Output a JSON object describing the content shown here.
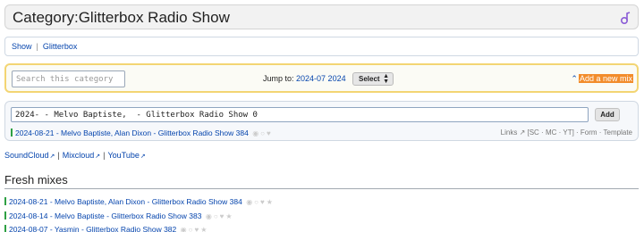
{
  "header": {
    "title": "Category:Glitterbox Radio Show",
    "logo_icon": "music-note-logo-icon"
  },
  "breadcrumb": {
    "items": [
      "Show",
      "Glitterbox"
    ]
  },
  "search": {
    "placeholder": "Search this category",
    "jump_label": "Jump to:",
    "jump_value": "2024-07 2024",
    "select_label": "Select",
    "add_mix_label": "Add a new mix"
  },
  "add_panel": {
    "input_value": "2024- - Melvo Baptiste,  - Glitterbox Radio Show 0",
    "add_button": "Add",
    "preview": "2024-08-21 - Melvo Baptiste, Alan Dixon - Glitterbox Radio Show 384",
    "tools_links": "Links",
    "tools_rest": "[SC · MC · YT] · Form · Template"
  },
  "external_links": [
    "SoundCloud",
    "Mixcloud",
    "YouTube"
  ],
  "fresh": {
    "heading": "Fresh mixes",
    "items": [
      "2024-08-21 - Melvo Baptiste, Alan Dixon - Glitterbox Radio Show 384",
      "2024-08-14 - Melvo Baptiste - Glitterbox Radio Show 383",
      "2024-08-07 - Yasmin - Glitterbox Radio Show 382"
    ]
  },
  "colors": {
    "accent": "#f28c2b",
    "link": "#0645ad",
    "highlight_border": "#f3d573",
    "bullet": "#2ea043"
  }
}
